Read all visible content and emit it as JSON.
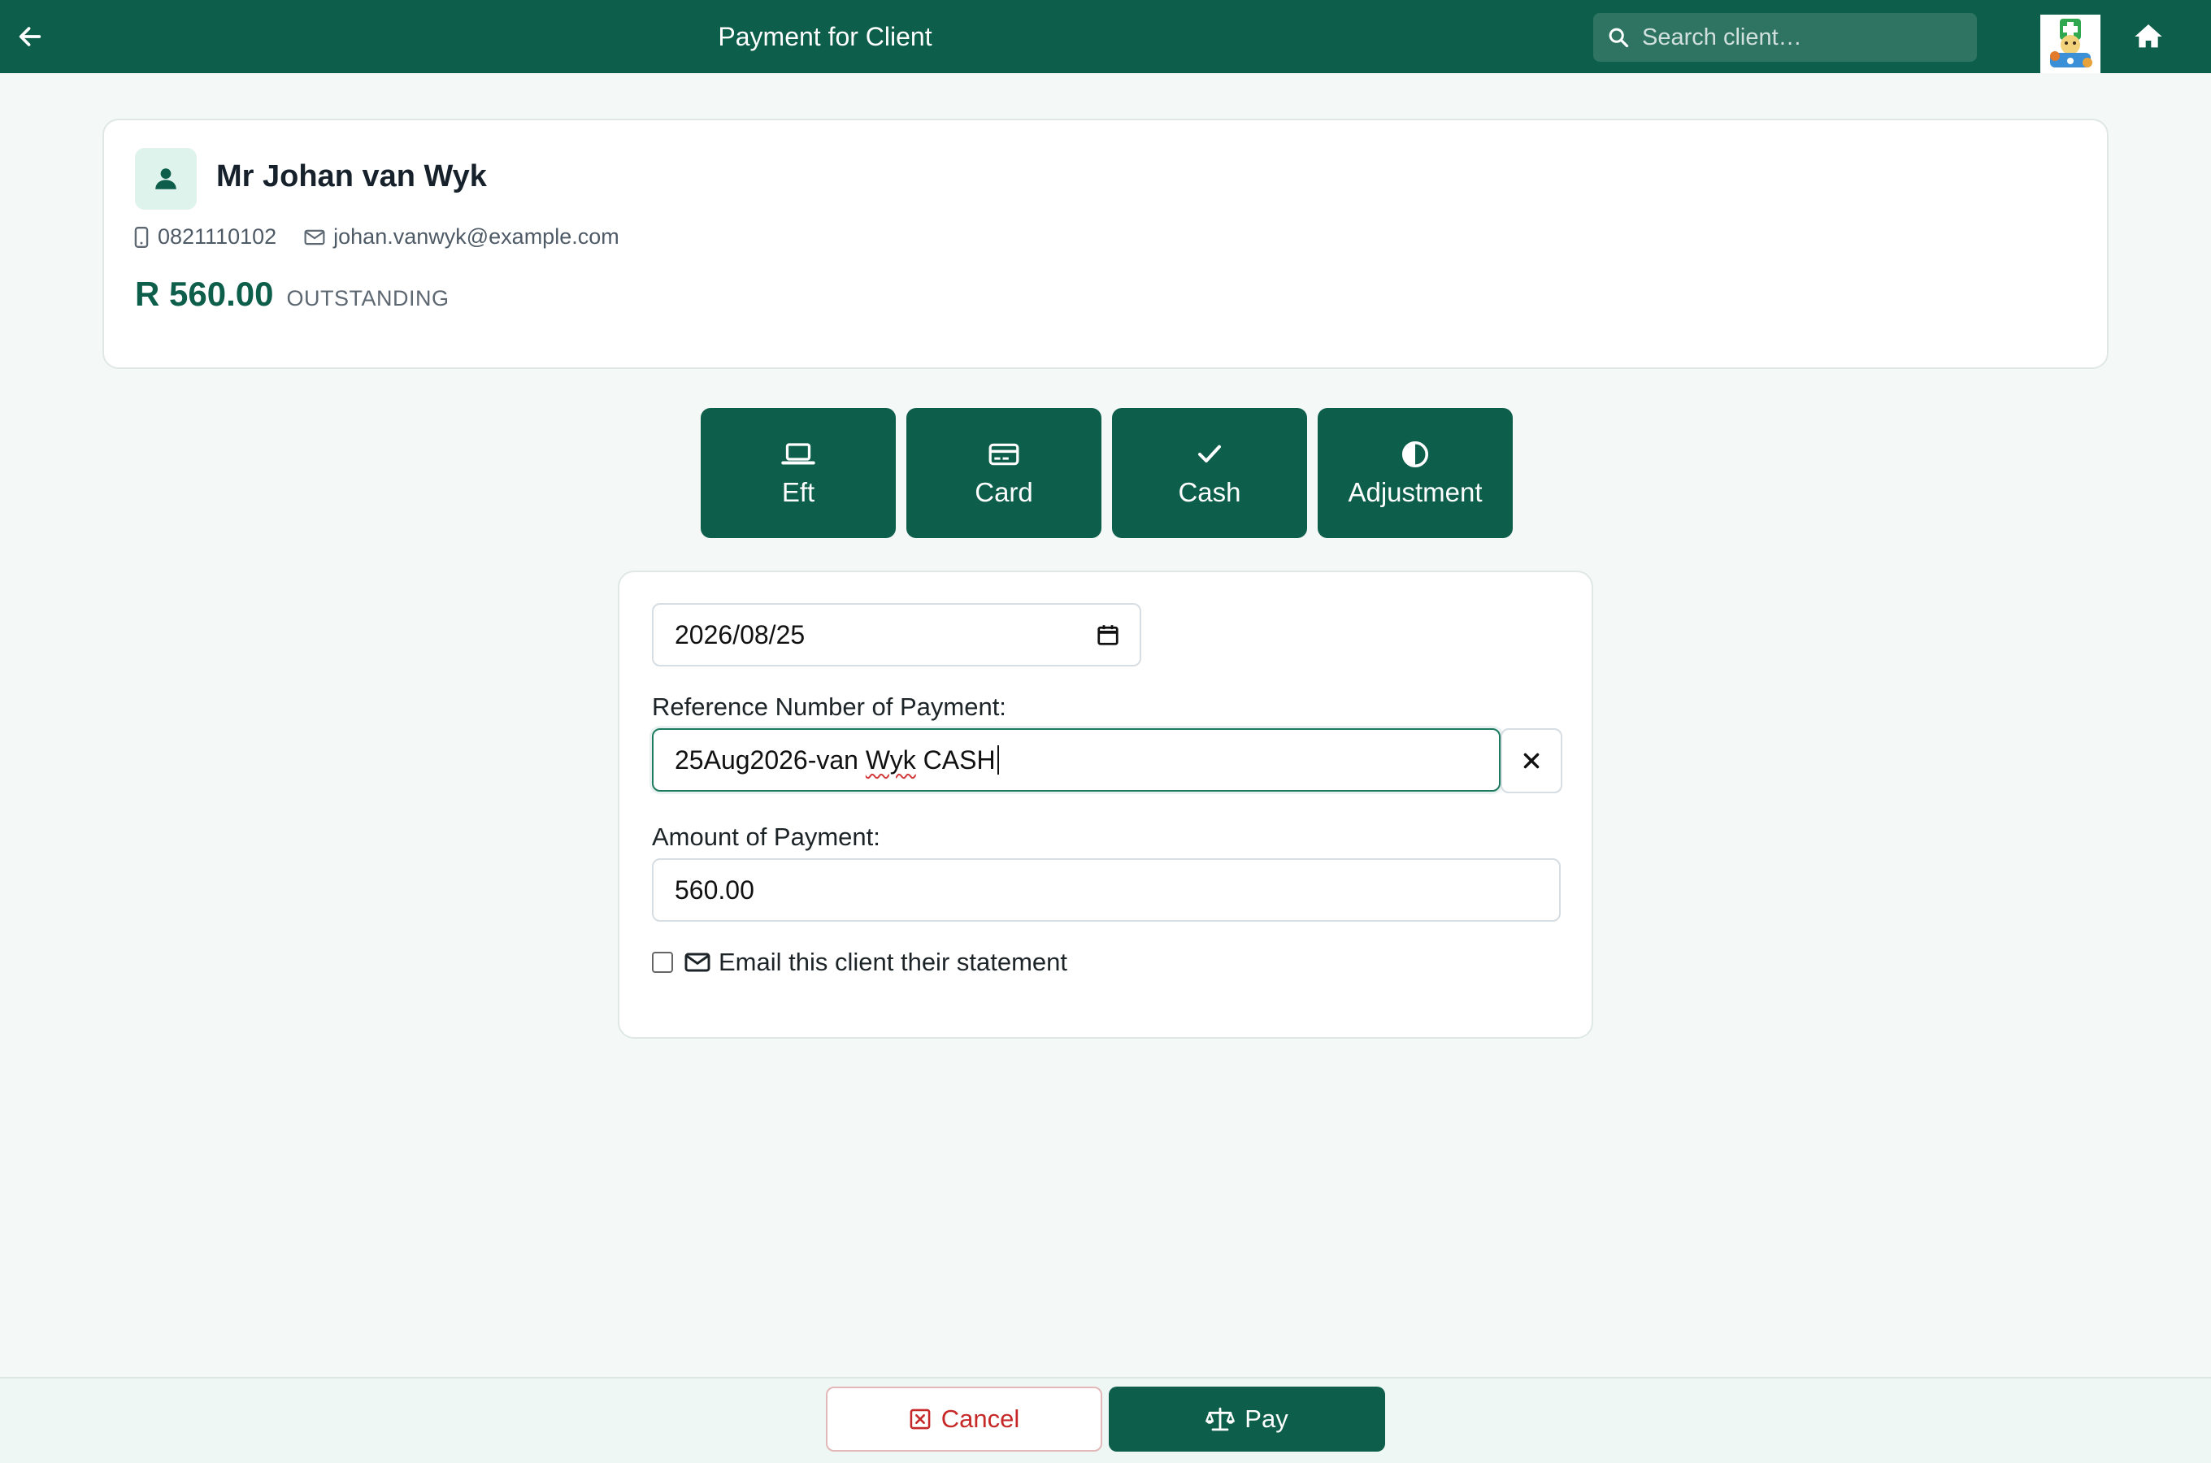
{
  "header": {
    "title": "Payment for Client",
    "search_placeholder": "Search client…"
  },
  "client": {
    "name": "Mr Johan van Wyk",
    "phone": "0821110102",
    "email": "johan.vanwyk@example.com",
    "balance": "R 560.00",
    "balance_status": "OUTSTANDING"
  },
  "payment_methods": [
    {
      "label": "Eft",
      "icon": "laptop-icon"
    },
    {
      "label": "Card",
      "icon": "credit-card-icon"
    },
    {
      "label": "Cash",
      "icon": "check-icon"
    },
    {
      "label": "Adjustment",
      "icon": "half-circle-icon"
    }
  ],
  "form": {
    "date_value": "2026/08/25",
    "reference_label": "Reference Number of Payment:",
    "reference_value_a": "25Aug2026-van ",
    "reference_value_b": "Wyk",
    "reference_value_c": " CASH",
    "amount_label": "Amount of Payment:",
    "amount_value": "560.00",
    "email_label": "Email this client their statement",
    "email_checked": false
  },
  "footer": {
    "cancel_label": "Cancel",
    "pay_label": "Pay"
  },
  "colors": {
    "primary": "#0d5e4a",
    "danger": "#c62828",
    "background": "#f4f9f7"
  }
}
